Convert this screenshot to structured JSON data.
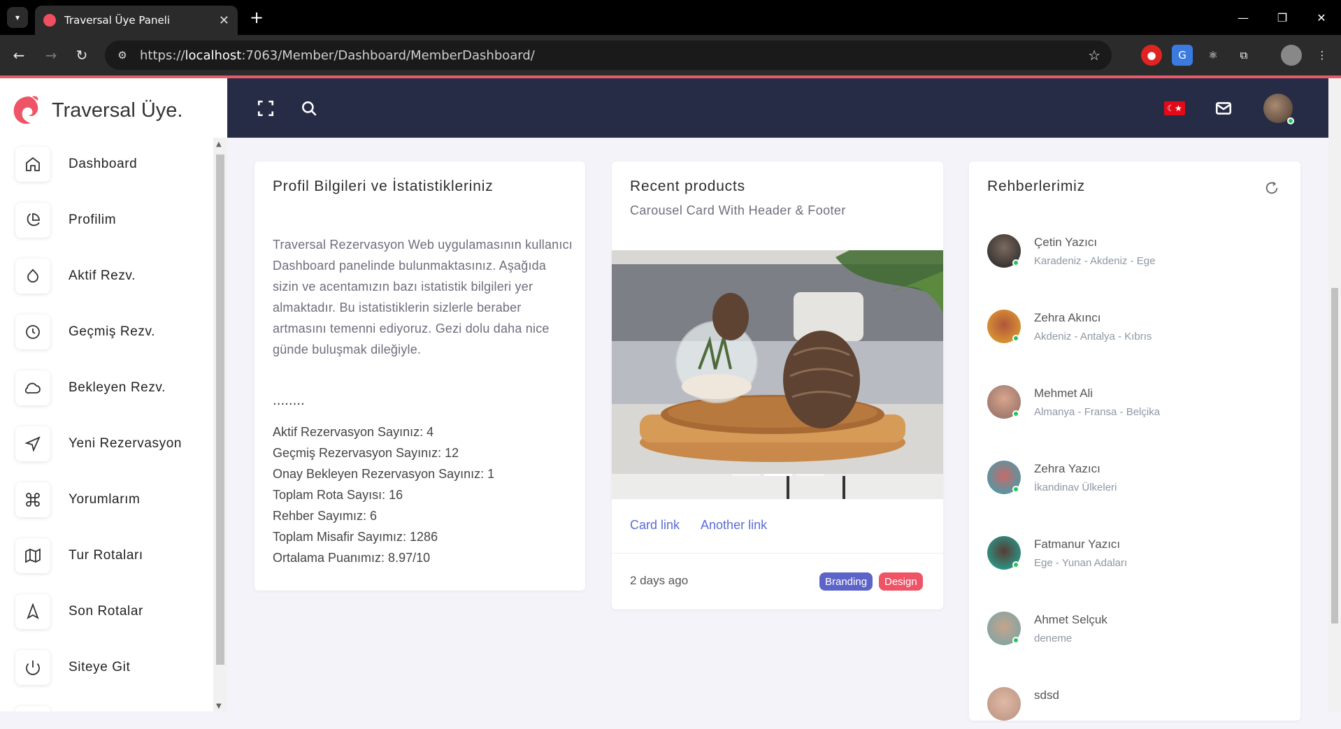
{
  "browser": {
    "tab_title": "Traversal Üye Paneli",
    "url_prefix": "https://",
    "url_host": "localhost",
    "url_path": ":7063/Member/Dashboard/MemberDashboard/"
  },
  "brand": {
    "name": "Traversal Üye."
  },
  "sidebar": {
    "items": [
      {
        "label": "Dashboard",
        "icon": "home-icon"
      },
      {
        "label": "Profilim",
        "icon": "pie-chart-icon"
      },
      {
        "label": "Aktif Rezv.",
        "icon": "droplet-icon"
      },
      {
        "label": "Geçmiş Rezv.",
        "icon": "clock-icon"
      },
      {
        "label": "Bekleyen Rezv.",
        "icon": "cloud-icon"
      },
      {
        "label": "Yeni Rezervasyon",
        "icon": "navigation-icon"
      },
      {
        "label": "Yorumlarım",
        "icon": "command-icon"
      },
      {
        "label": "Tur Rotaları",
        "icon": "map-icon"
      },
      {
        "label": "Son Rotalar",
        "icon": "navigation-2-icon"
      },
      {
        "label": "Siteye Git",
        "icon": "power-icon"
      }
    ]
  },
  "profile_card": {
    "title": "Profil Bilgileri ve İstatistikleriniz",
    "description": "Traversal Rezervasyon Web uygulamasının kullanıcı Dashboard panelinde bulunmaktasınız. Aşağıda sizin ve acentamızın bazı istatistik bilgileri yer almaktadır. Bu istatistiklerin sizlerle beraber artmasını temenni ediyoruz. Gezi dolu daha nice günde buluşmak dileğiyle.",
    "dots": "........",
    "stats": [
      "Aktif Rezervasyon Sayınız: 4",
      "Geçmiş Rezervasyon Sayınız: 12",
      "Onay Bekleyen Rezervasyon Sayınız: 1",
      "Toplam Rota Sayısı: 16",
      "Rehber Sayımız: 6",
      "Toplam Misafir Sayımız: 1286",
      "Ortalama Puanımız: 8.97/10"
    ]
  },
  "products_card": {
    "title": "Recent products",
    "subtitle": "Carousel Card With Header & Footer",
    "link1": "Card link",
    "link2": "Another link",
    "time": "2 days ago",
    "badge1": "Branding",
    "badge2": "Design",
    "colors": {
      "badge1": "#5c64c8",
      "badge2": "#ef5466"
    }
  },
  "guides_card": {
    "title": "Rehberlerimiz",
    "guides": [
      {
        "name": "Çetin Yazıcı",
        "routes": "Karadeniz - Akdeniz - Ege"
      },
      {
        "name": "Zehra Akıncı",
        "routes": "Akdeniz - Antalya - Kıbrıs"
      },
      {
        "name": "Mehmet Ali",
        "routes": "Almanya - Fransa - Belçika"
      },
      {
        "name": "Zehra Yazıcı",
        "routes": "İkandinav Ülkeleri"
      },
      {
        "name": "Fatmanur Yazıcı",
        "routes": "Ege - Yunan Adaları"
      },
      {
        "name": "Ahmet Selçuk",
        "routes": "deneme"
      },
      {
        "name": "sdsd",
        "routes": ""
      }
    ]
  },
  "topbar": {
    "flag_symbol": "☾★"
  }
}
